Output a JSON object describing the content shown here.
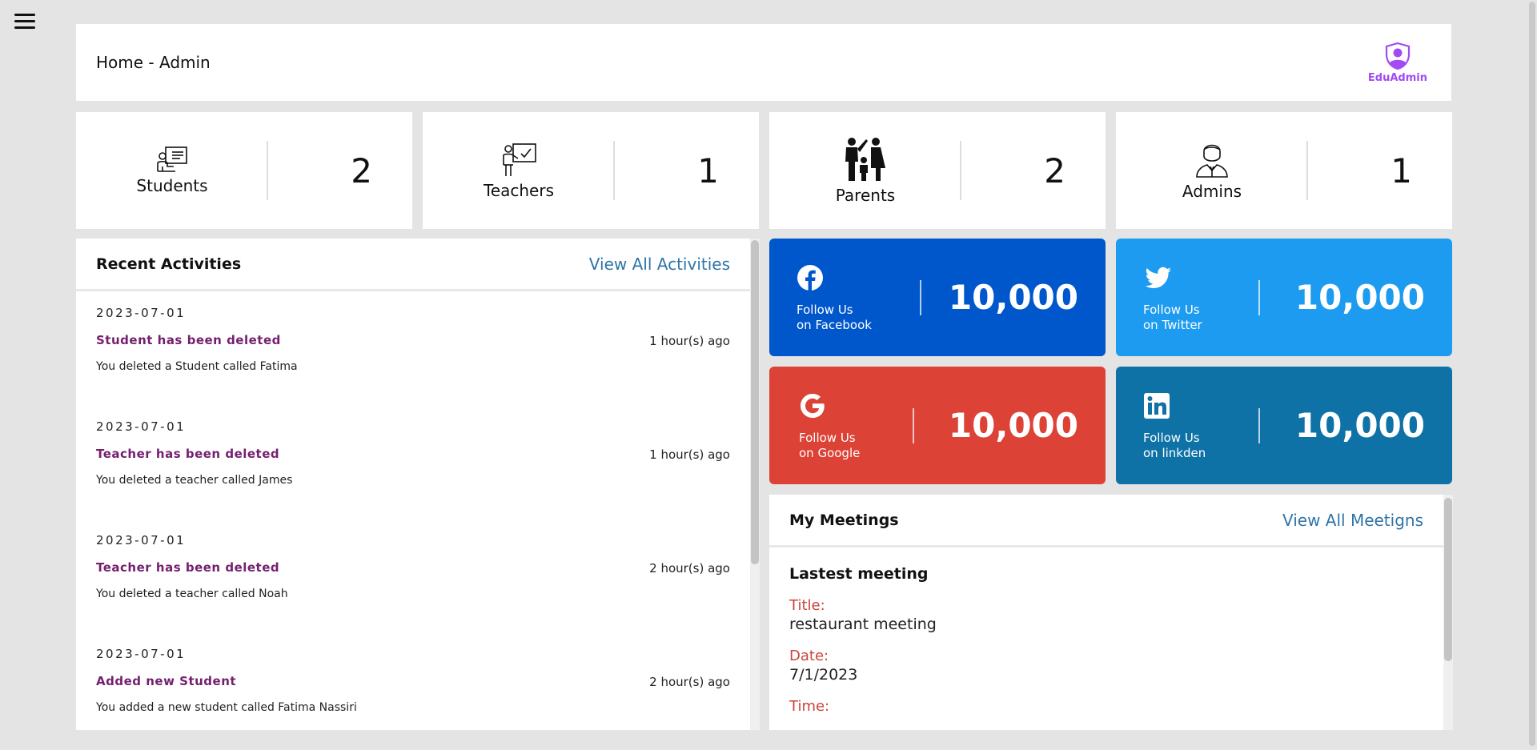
{
  "header": {
    "title": "Home - Admin",
    "brand": "EduAdmin"
  },
  "stats": [
    {
      "label": "Students",
      "count": "2"
    },
    {
      "label": "Teachers",
      "count": "1"
    },
    {
      "label": "Parents",
      "count": "2"
    },
    {
      "label": "Admins",
      "count": "1"
    }
  ],
  "activities": {
    "title": "Recent Activities",
    "link": "View All Activities",
    "items": [
      {
        "date": "2023-07-01",
        "title": "Student has been deleted",
        "time": "1 hour(s) ago",
        "desc": "You deleted a Student called Fatima"
      },
      {
        "date": "2023-07-01",
        "title": "Teacher has been deleted",
        "time": "1 hour(s) ago",
        "desc": "You deleted a teacher called James"
      },
      {
        "date": "2023-07-01",
        "title": "Teacher has been deleted",
        "time": "2 hour(s) ago",
        "desc": "You deleted a teacher called Noah"
      },
      {
        "date": "2023-07-01",
        "title": "Added new Student",
        "time": "2 hour(s) ago",
        "desc": "You added a new student called Fatima Nassiri"
      }
    ]
  },
  "social": [
    {
      "line1": "Follow Us",
      "line2": "on Facebook",
      "count": "10,000",
      "color": "#0057cc",
      "icon": "facebook-icon"
    },
    {
      "line1": "Follow Us",
      "line2": "on Twitter",
      "count": "10,000",
      "color": "#1d9bf0",
      "icon": "twitter-icon"
    },
    {
      "line1": "Follow Us",
      "line2": "on Google",
      "count": "10,000",
      "color": "#dd4237",
      "icon": "google-icon"
    },
    {
      "line1": "Follow Us",
      "line2": "on linkden",
      "count": "10,000",
      "color": "#0f72a7",
      "icon": "linkedin-icon"
    }
  ],
  "meetings": {
    "title": "My Meetings",
    "link": "View All Meetigns",
    "heading": "Lastest meeting",
    "fields": [
      {
        "label": "Title:",
        "value": "restaurant meeting"
      },
      {
        "label": "Date:",
        "value": "7/1/2023"
      },
      {
        "label": "Time:",
        "value": ""
      }
    ]
  }
}
